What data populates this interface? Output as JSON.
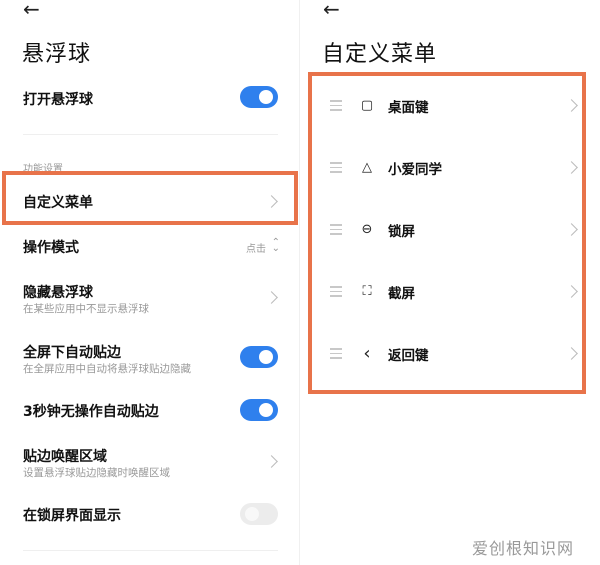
{
  "left": {
    "back_glyph": "←",
    "title": "悬浮球",
    "open_ball": {
      "label": "打开悬浮球",
      "on": true
    },
    "section_label": "功能设置",
    "custom_menu": {
      "label": "自定义菜单"
    },
    "operation_mode": {
      "label": "操作模式",
      "value": "点击",
      "arrows": "⌃⌄"
    },
    "hide_ball": {
      "label": "隐藏悬浮球",
      "sub": "在某些应用中不显示悬浮球"
    },
    "fullscreen_edge": {
      "label": "全屏下自动贴边",
      "sub": "在全屏应用中自动将悬浮球贴边隐藏",
      "on": true
    },
    "idle_edge": {
      "label": "3秒钟无操作自动贴边",
      "on": true
    },
    "edge_wake": {
      "label": "贴边唤醒区域",
      "sub": "设置悬浮球贴边隐藏时唤醒区域"
    },
    "lockscreen": {
      "label": "在锁屏界面显示",
      "on": false
    }
  },
  "right": {
    "back_glyph": "←",
    "title": "自定义菜单",
    "items": [
      {
        "label": "桌面键",
        "icon": "home-square-icon",
        "glyph": "▢"
      },
      {
        "label": "小爱同学",
        "icon": "xiaoai-icon",
        "glyph": "△"
      },
      {
        "label": "锁屏",
        "icon": "lock-icon",
        "glyph": "⊖"
      },
      {
        "label": "截屏",
        "icon": "screenshot-icon",
        "glyph": "⛶"
      },
      {
        "label": "返回键",
        "icon": "back-arrow-icon",
        "glyph": "‹"
      }
    ]
  },
  "colors": {
    "accent": "#2f80ed",
    "highlight": "#e8734a"
  },
  "watermark": "爱创根知识网"
}
